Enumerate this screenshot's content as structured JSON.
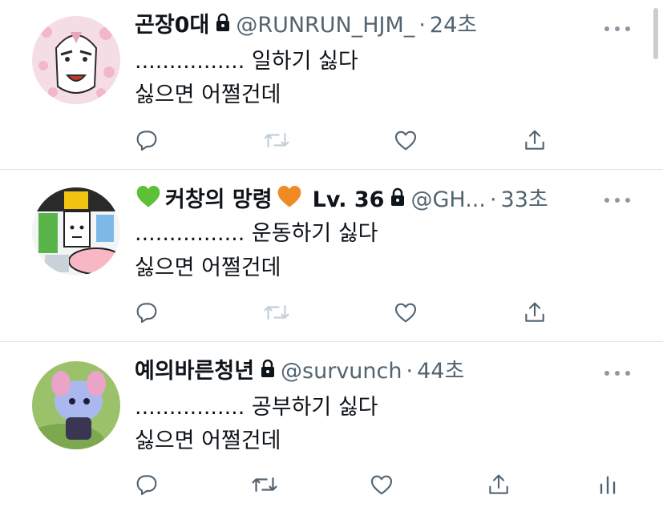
{
  "tweets": [
    {
      "display_name": "곤장0대",
      "handle": "@RUNRUN_HJM_",
      "separator": "·",
      "time": "24초",
      "line1": "................ 일하기 싫다",
      "line2": "싫으면 어쩔건데",
      "avatar_bg": "#f5dde6"
    },
    {
      "display_name": "커창의 망령",
      "level": "Lv. 36",
      "handle": "@GH...",
      "separator": "·",
      "time": "33초",
      "line1": "................ 운동하기 싫다",
      "line2": "싫으면 어쩔건데",
      "avatar_bg": "#e8edf0"
    },
    {
      "display_name": "예의바른청년",
      "handle": "@survunch",
      "separator": "·",
      "time": "44초",
      "line1": "................ 공부하기 싫다",
      "line2": "싫으면 어쩔건데",
      "avatar_bg": "#9bc26a"
    }
  ],
  "icons": {
    "reply": "reply-icon",
    "retweet": "retweet-icon",
    "like": "like-icon",
    "share": "share-icon",
    "analytics": "analytics-icon",
    "lock": "lock-icon",
    "more": "more-icon"
  },
  "colors": {
    "text": "#0f1419",
    "secondary": "#536471",
    "icon": "#536471",
    "green_heart": "#5cc137",
    "orange_heart": "#f08a24"
  }
}
